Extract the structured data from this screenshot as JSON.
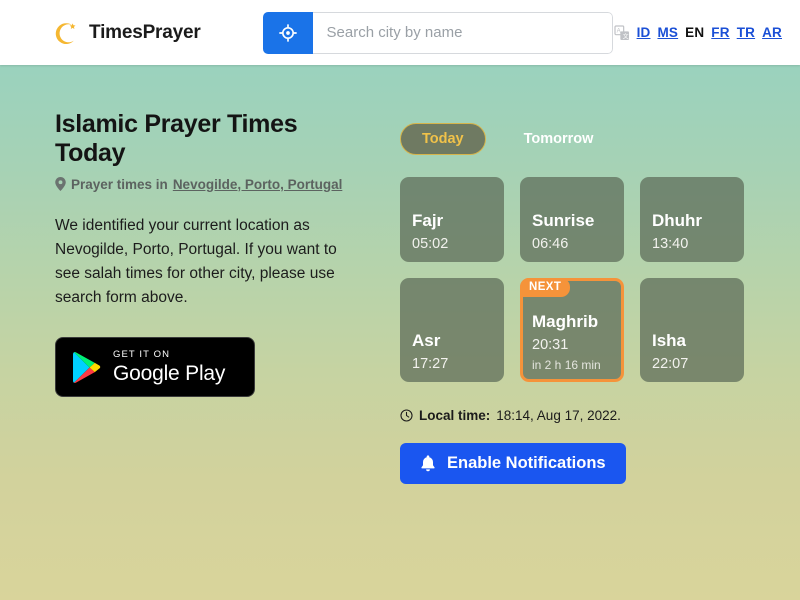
{
  "header": {
    "brand_name": "TimesPrayer",
    "brand_icon": "crescent-moon-star-icon",
    "locate_icon": "my-location-crosshair-icon",
    "search": {
      "placeholder": "Search city by name",
      "value": ""
    },
    "translate_icon": "translate-icon",
    "languages": [
      {
        "code": "ID",
        "active": false
      },
      {
        "code": "MS",
        "active": false
      },
      {
        "code": "EN",
        "active": true
      },
      {
        "code": "FR",
        "active": false
      },
      {
        "code": "TR",
        "active": false
      },
      {
        "code": "AR",
        "active": false
      }
    ]
  },
  "left": {
    "title": "Islamic Prayer Times Today",
    "pin_icon": "map-pin-icon",
    "subtitle_prefix": "Prayer times in",
    "subtitle_location": "Nevogilde, Porto, Portugal",
    "intro": "We identified your current location as Nevogilde, Porto, Portugal. If you want to see salah times for other city, please use search form above.",
    "google_play": {
      "small_text": "GET IT ON",
      "big_text": "Google Play",
      "icon": "google-play-triangle-icon"
    }
  },
  "right": {
    "tabs": [
      {
        "label": "Today",
        "active": true
      },
      {
        "label": "Tomorrow",
        "active": false
      }
    ],
    "prayers": [
      {
        "name": "Fajr",
        "time": "05:02",
        "countdown": "",
        "next": false
      },
      {
        "name": "Sunrise",
        "time": "06:46",
        "countdown": "",
        "next": false
      },
      {
        "name": "Dhuhr",
        "time": "13:40",
        "countdown": "",
        "next": false
      },
      {
        "name": "Asr",
        "time": "17:27",
        "countdown": "",
        "next": false
      },
      {
        "name": "Maghrib",
        "time": "20:31",
        "countdown": "in 2 h 16 min",
        "next": true
      },
      {
        "name": "Isha",
        "time": "22:07",
        "countdown": "",
        "next": false
      }
    ],
    "next_badge_label": "NEXT",
    "clock_icon": "clock-icon",
    "local_time_label": "Local time:",
    "local_time_value": "18:14, Aug 17, 2022.",
    "notify": {
      "icon": "bell-icon",
      "label": "Enable Notifications"
    }
  },
  "colors": {
    "accent_blue": "#1a73e8",
    "notify_blue": "#1a56f0",
    "next_orange": "#f5933a",
    "tab_gold": "#f0c24a",
    "card_bg": "#5c6958",
    "bg_top": "#8ed0c0",
    "bg_bottom": "#d9d49b"
  }
}
